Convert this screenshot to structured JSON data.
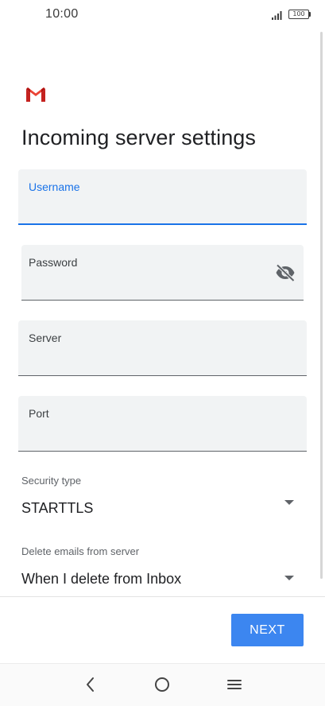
{
  "status_bar": {
    "time": "10:00",
    "battery": "100"
  },
  "page": {
    "title": "Incoming server settings"
  },
  "fields": {
    "username": {
      "label": "Username",
      "value": ""
    },
    "password": {
      "label": "Password",
      "value": ""
    },
    "server": {
      "label": "Server",
      "value": ""
    },
    "port": {
      "label": "Port",
      "value": ""
    }
  },
  "security": {
    "label": "Security type",
    "value": "STARTTLS"
  },
  "delete_emails": {
    "label": "Delete emails from server",
    "value": "When I delete from Inbox"
  },
  "actions": {
    "next_label": "NEXT"
  },
  "colors": {
    "accent": "#1a73e8",
    "button": "#3c86f0",
    "field_bg": "#f1f3f4"
  },
  "icons": [
    "gmail-logo",
    "eye-off-icon",
    "dropdown-arrow-icon",
    "back-icon",
    "home-icon",
    "menu-icon",
    "signal-icon",
    "battery-icon"
  ]
}
